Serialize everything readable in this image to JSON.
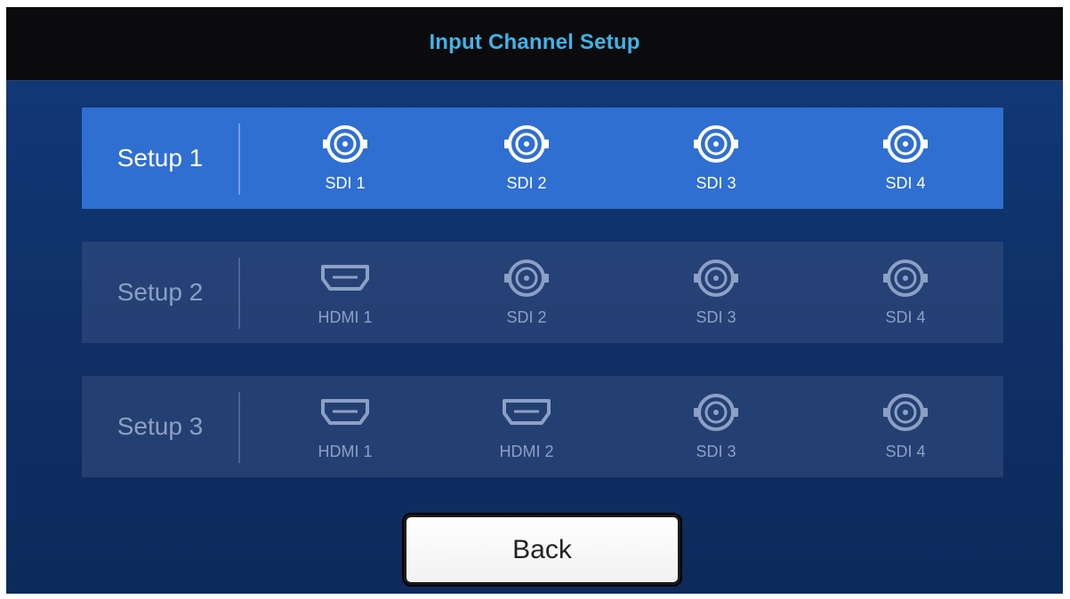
{
  "header": {
    "title": "Input Channel Setup"
  },
  "setups": [
    {
      "label": "Setup 1",
      "selected": true,
      "ports": [
        {
          "type": "sdi",
          "label": "SDI 1"
        },
        {
          "type": "sdi",
          "label": "SDI 2"
        },
        {
          "type": "sdi",
          "label": "SDI 3"
        },
        {
          "type": "sdi",
          "label": "SDI 4"
        }
      ]
    },
    {
      "label": "Setup 2",
      "selected": false,
      "ports": [
        {
          "type": "hdmi",
          "label": "HDMI 1"
        },
        {
          "type": "sdi",
          "label": "SDI 2"
        },
        {
          "type": "sdi",
          "label": "SDI 3"
        },
        {
          "type": "sdi",
          "label": "SDI 4"
        }
      ]
    },
    {
      "label": "Setup 3",
      "selected": false,
      "ports": [
        {
          "type": "hdmi",
          "label": "HDMI 1"
        },
        {
          "type": "hdmi",
          "label": "HDMI 2"
        },
        {
          "type": "sdi",
          "label": "SDI 3"
        },
        {
          "type": "sdi",
          "label": "SDI 4"
        }
      ]
    }
  ],
  "footer": {
    "back_label": "Back"
  },
  "colors": {
    "title": "#3fb4ea",
    "selected_row": "#2f6fd2",
    "background": "#123a7a",
    "inactive_text": "#8ba0c4"
  },
  "icons": {
    "sdi": "bnc-connector-icon",
    "hdmi": "hdmi-port-icon"
  }
}
